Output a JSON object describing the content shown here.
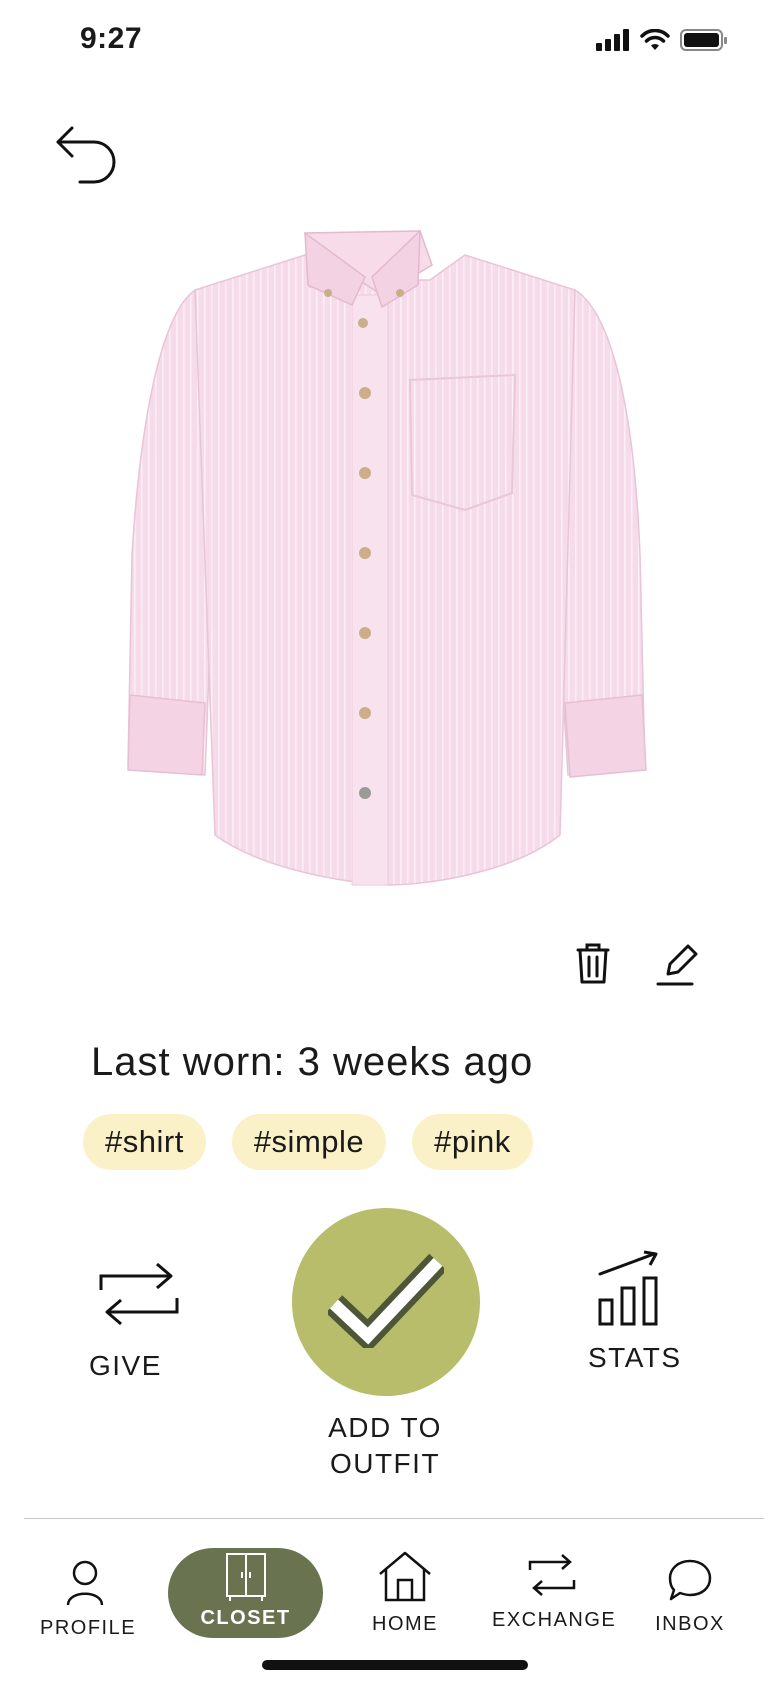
{
  "status_bar": {
    "time": "9:27"
  },
  "item": {
    "last_worn": "Last worn: 3 weeks ago",
    "tags": [
      "#shirt",
      "#simple",
      "#pink"
    ]
  },
  "actions": {
    "give_label": "GIVE",
    "add_label_line1": "ADD TO",
    "add_label_line2": "OUTFIT",
    "stats_label": "STATS"
  },
  "nav": {
    "items": [
      {
        "label": "PROFILE",
        "icon": "profile-icon"
      },
      {
        "label": "CLOSET",
        "icon": "closet-icon",
        "active": true
      },
      {
        "label": "HOME",
        "icon": "home-icon"
      },
      {
        "label": "EXCHANGE",
        "icon": "exchange-icon"
      },
      {
        "label": "INBOX",
        "icon": "inbox-icon"
      }
    ]
  },
  "colors": {
    "accent": "#b8bd6b",
    "nav_active": "#6a7350",
    "tag_bg": "#fbf1c8",
    "shirt": "#f5d8ea"
  }
}
